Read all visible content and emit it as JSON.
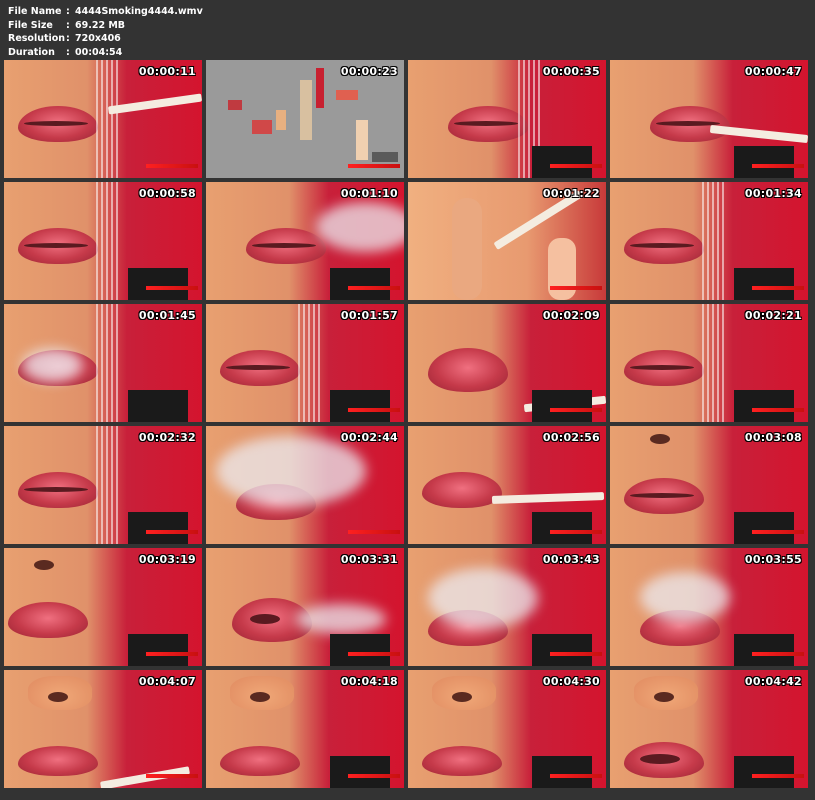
{
  "file_info": {
    "rows": [
      {
        "label": "File Name",
        "sep": ":",
        "value": "4444Smoking4444.wmv"
      },
      {
        "label": "File Size",
        "sep": ":",
        "value": "69.22 MB"
      },
      {
        "label": "Resolution",
        "sep": ":",
        "value": "720x406"
      },
      {
        "label": "Duration",
        "sep": ":",
        "value": "00:04:54"
      }
    ]
  },
  "thumbnails": [
    {
      "timestamp": "00:00:11"
    },
    {
      "timestamp": "00:00:23"
    },
    {
      "timestamp": "00:00:35"
    },
    {
      "timestamp": "00:00:47"
    },
    {
      "timestamp": "00:00:58"
    },
    {
      "timestamp": "00:01:10"
    },
    {
      "timestamp": "00:01:22"
    },
    {
      "timestamp": "00:01:34"
    },
    {
      "timestamp": "00:01:45"
    },
    {
      "timestamp": "00:01:57"
    },
    {
      "timestamp": "00:02:09"
    },
    {
      "timestamp": "00:02:21"
    },
    {
      "timestamp": "00:02:32"
    },
    {
      "timestamp": "00:02:44"
    },
    {
      "timestamp": "00:02:56"
    },
    {
      "timestamp": "00:03:08"
    },
    {
      "timestamp": "00:03:19"
    },
    {
      "timestamp": "00:03:31"
    },
    {
      "timestamp": "00:03:43"
    },
    {
      "timestamp": "00:03:55"
    },
    {
      "timestamp": "00:04:07"
    },
    {
      "timestamp": "00:04:18"
    },
    {
      "timestamp": "00:04:30"
    },
    {
      "timestamp": "00:04:42"
    }
  ],
  "colors": {
    "background": "#333333",
    "text": "#ffffff",
    "frame_red": "#d4142e",
    "lip_pink": "#c63a4a"
  }
}
